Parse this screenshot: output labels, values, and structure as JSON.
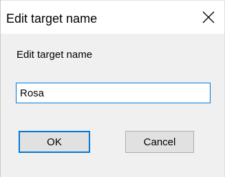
{
  "dialog": {
    "title": "Edit target name",
    "prompt": "Edit target name",
    "input_value": "Rosa",
    "ok_label": "OK",
    "cancel_label": "Cancel",
    "close_icon": "close-icon"
  },
  "colors": {
    "focus_accent": "#0078d7",
    "client_background": "#f0f0f0",
    "button_face": "#e1e1e1",
    "button_border": "#adadad"
  }
}
